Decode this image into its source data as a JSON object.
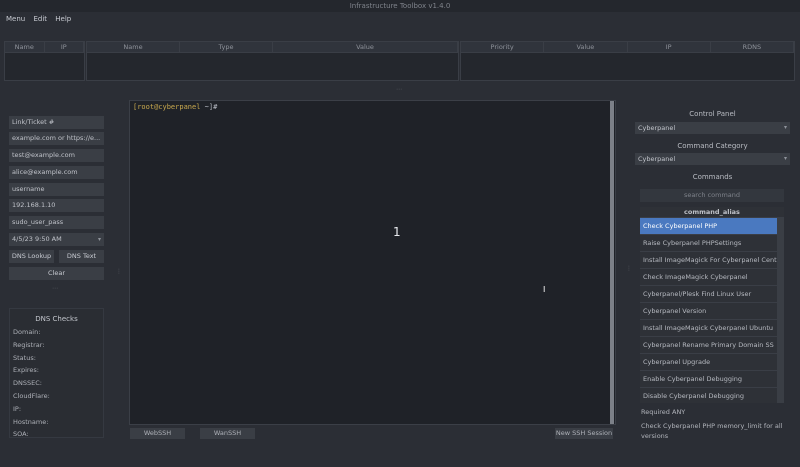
{
  "window": {
    "title": "Infrastructure Toolbox v1.4.0"
  },
  "menu": [
    "Menu",
    "Edit",
    "Help"
  ],
  "tables": {
    "left_columns": [
      "Name",
      "IP"
    ],
    "middle_columns": [
      "Name",
      "Type",
      "Value"
    ],
    "right_columns": [
      "Priority",
      "Value",
      "IP",
      "RDNS"
    ]
  },
  "left_fields": [
    "Link/Ticket #",
    "example.com or https://e...",
    "test@example.com",
    "alice@example.com",
    "username",
    "192.168.1.10",
    "sudo_user_pass",
    "4/5/23 9:50 AM"
  ],
  "buttons": {
    "dns_lookup": "DNS Lookup",
    "dns_text": "DNS Text",
    "clear": "Clear"
  },
  "dns_checks": {
    "title": "DNS Checks",
    "items": [
      "Domain:",
      "Registrar:",
      "Status:",
      "Expires:",
      "DNSSEC:",
      "CloudFlare:",
      "IP:",
      "Hostname:",
      "SOA:"
    ]
  },
  "terminal": {
    "prompt_user": "[root@cyberpanel",
    "prompt_rest": " ~]# ",
    "center_text": "1"
  },
  "bottom_tabs": {
    "webssh": "WebSSH",
    "wanssh": "WanSSH",
    "new_session": "New SSH Session"
  },
  "right_panel": {
    "control_panel_label": "Control Panel",
    "control_panel_value": "Cyberpanel",
    "command_category_label": "Command Category",
    "command_category_value": "Cyberpanel",
    "commands_label": "Commands",
    "search_placeholder": "search command",
    "list_header": "command_alias",
    "commands": [
      "Check Cyberpanel PHP",
      "Raise Cyberpanel PHPSettings",
      "Install ImageMagick For Cyberpanel Cent",
      "Check ImageMagick Cyberpanel",
      "Cyberpanel/Plesk Find Linux User",
      "Cyberpanel Version",
      "Install ImageMagick Cyberpanel Ubuntu",
      "Cyberpanel Rename Primary Domain SS",
      "Cyberpanel Upgrade",
      "Enable Cyberpanel Debugging",
      "Disable Cyberpanel Debugging"
    ],
    "required_label": "Required ANY",
    "description": "Check Cyberpanel PHP memory_limit for all versions"
  }
}
